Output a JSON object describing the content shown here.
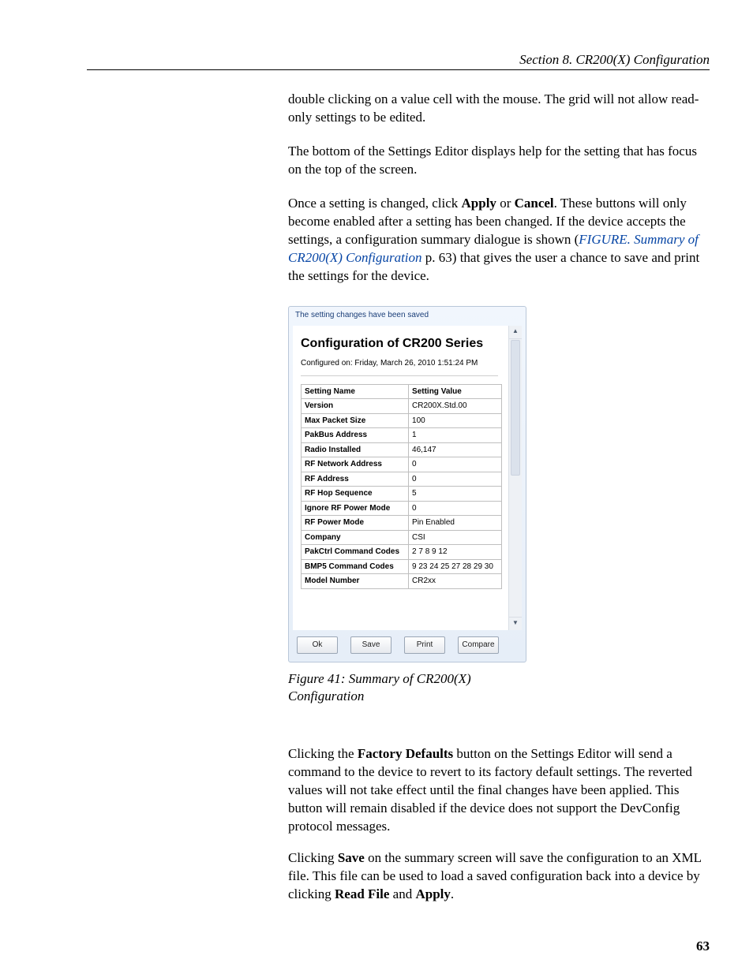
{
  "header": {
    "section": "Section 8.  CR200(X) Configuration"
  },
  "body": {
    "p1": "double clicking on a value cell with the mouse. The grid will not allow read-only settings to be edited.",
    "p2": "The bottom of the Settings Editor displays help for the setting that has focus on the top of the screen.",
    "p3a": "Once a setting is changed, click ",
    "apply": "Apply",
    "p3b": " or ",
    "cancel": "Cancel",
    "p3c": ". These buttons will only become enabled after a setting has been changed. If the device accepts the settings, a configuration summary dialogue is shown (",
    "figlink": "FIGURE. Summary of CR200(X) Configuration",
    "p3d": " p. 63) that gives the user a chance to save and print the settings for the device."
  },
  "dialog": {
    "title": "The setting changes have been saved",
    "heading": "Configuration of CR200 Series",
    "sub": "Configured on: Friday, March 26, 2010 1:51:24 PM",
    "th1": "Setting Name",
    "th2": "Setting Value",
    "rows": [
      {
        "n": "Version",
        "v": "CR200X.Std.00"
      },
      {
        "n": "Max Packet Size",
        "v": "100"
      },
      {
        "n": "PakBus Address",
        "v": "1"
      },
      {
        "n": "Radio Installed",
        "v": "46,147"
      },
      {
        "n": "RF Network Address",
        "v": "0"
      },
      {
        "n": "RF Address",
        "v": "0"
      },
      {
        "n": "RF Hop Sequence",
        "v": "5"
      },
      {
        "n": "Ignore RF Power Mode",
        "v": "0"
      },
      {
        "n": "RF Power Mode",
        "v": "Pin Enabled"
      },
      {
        "n": "Company",
        "v": "CSI"
      },
      {
        "n": "PakCtrl Command Codes",
        "v": "2 7 8 9 12"
      },
      {
        "n": "BMP5 Command Codes",
        "v": "9 23 24 25 27 28 29 30"
      },
      {
        "n": "Model Number",
        "v": "CR2xx"
      }
    ],
    "btn_ok": "Ok",
    "btn_save": "Save",
    "btn_print": "Print",
    "btn_compare": "Compare"
  },
  "caption": "Figure 41: Summary of CR200(X) Configuration",
  "body2": {
    "p1a": "Clicking the ",
    "fd": "Factory Defaults",
    "p1b": " button on the Settings Editor will send a command to the device to revert to its factory default settings. The reverted values will not take effect until the final changes have been applied. This button will remain disabled if the device does not support the DevConfig protocol messages.",
    "p2a": "Clicking ",
    "save": "Save",
    "p2b": " on the summary screen will save the configuration to an XML file. This file can be used to load a saved configuration back into a device by clicking ",
    "rf": "Read File",
    "p2c": " and ",
    "apply": "Apply",
    "p2d": "."
  },
  "page": "63"
}
